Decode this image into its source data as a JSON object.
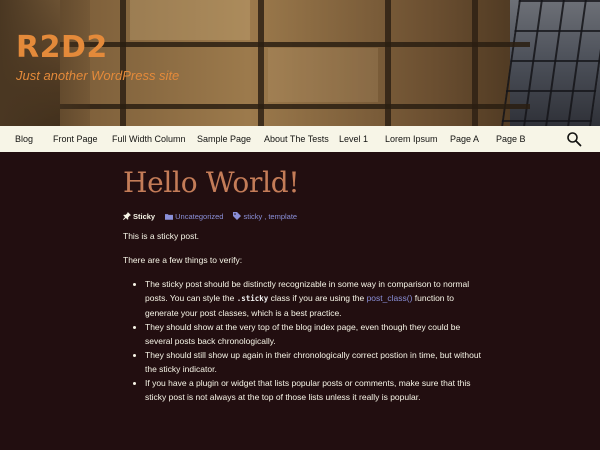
{
  "header": {
    "site_title": "R2D2",
    "site_tagline": "Just another WordPress site"
  },
  "nav": {
    "items": [
      {
        "label": "Blog"
      },
      {
        "label": "Front Page"
      },
      {
        "label": "Full Width Column"
      },
      {
        "label": "Sample Page"
      },
      {
        "label": "About The Tests"
      },
      {
        "label": "Level 1"
      },
      {
        "label": "Lorem Ipsum"
      },
      {
        "label": "Page A"
      },
      {
        "label": "Page B"
      }
    ],
    "search_icon": "search-icon"
  },
  "post": {
    "title": "Hello World!",
    "meta": {
      "sticky_label": "Sticky",
      "category": "Uncategorized",
      "tag_1": "sticky",
      "tag_sep": ", ",
      "tag_2": "template"
    },
    "paragraph_1": "This is a sticky post.",
    "paragraph_2": "There are a few things to verify:",
    "list": {
      "item_1_part_1": "The sticky post should be distinctly recognizable in some way in comparison to normal posts. You can style the ",
      "item_1_code": ".sticky",
      "item_1_part_2": " class if you are using the ",
      "item_1_link": "post_class()",
      "item_1_part_3": " function to generate your post classes, which is a best practice.",
      "item_2": "They should show at the very top of the blog index page, even though they could be several posts back chronologically.",
      "item_3": "They should still show up again in their chronologically correct postion in time, but without the sticky indicator.",
      "item_4": "If you have a plugin or widget that lists popular posts or comments, make sure that this sticky post is not always at the top of those lists unless it really is popular."
    }
  },
  "colors": {
    "background": "#220e10",
    "nav_background": "#f7f5e7",
    "title_color": "#c47c58",
    "site_title_color": "#e48a3a",
    "link_color": "#8a8fd8",
    "text_color": "#f7f5e7"
  }
}
